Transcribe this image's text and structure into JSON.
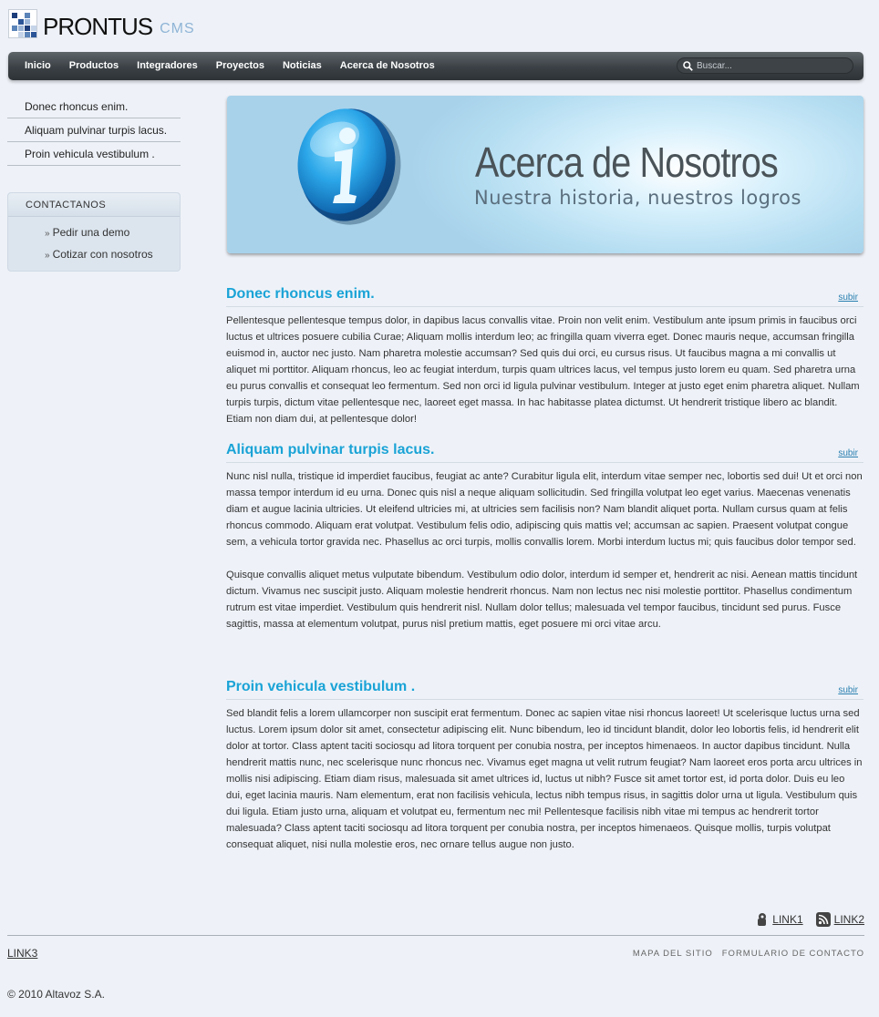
{
  "logo": {
    "name": "PRONTUS",
    "sub": "CMS"
  },
  "nav": {
    "items": [
      "Inicio",
      "Productos",
      "Integradores",
      "Proyectos",
      "Noticias",
      "Acerca de Nosotros"
    ],
    "search_placeholder": "Buscar..."
  },
  "sidebar": {
    "links": [
      "Donec rhoncus enim.",
      "Aliquam pulvinar turpis lacus.",
      "Proin vehicula vestibulum ."
    ],
    "contact": {
      "title": "CONTACTANOS",
      "items": [
        "Pedir una demo",
        "Cotizar con nosotros"
      ]
    }
  },
  "banner": {
    "title": "Acerca de Nosotros",
    "subtitle": "Nuestra historia, nuestros logros"
  },
  "articles": [
    {
      "title": "Donec rhoncus enim.",
      "up": "subir",
      "paragraphs": [
        "Pellentesque pellentesque tempus dolor, in dapibus lacus convallis vitae. Proin non velit enim. Vestibulum ante ipsum primis in faucibus orci luctus et ultrices posuere cubilia Curae; Aliquam mollis interdum leo; ac fringilla quam viverra eget. Donec mauris neque, accumsan fringilla euismod in, auctor nec justo. Nam pharetra molestie accumsan? Sed quis dui orci, eu cursus risus. Ut faucibus magna a mi convallis ut aliquet mi porttitor. Aliquam rhoncus, leo ac feugiat interdum, turpis quam ultrices lacus, vel tempus justo lorem eu quam. Sed pharetra urna eu purus convallis et consequat leo fermentum. Sed non orci id ligula pulvinar vestibulum. Integer at justo eget enim pharetra aliquet. Nullam turpis turpis, dictum vitae pellentesque nec, laoreet eget massa. In hac habitasse platea dictumst. Ut hendrerit tristique libero ac blandit. Etiam non diam dui, at pellentesque dolor!"
      ]
    },
    {
      "title": "Aliquam pulvinar turpis lacus.",
      "up": "subir",
      "paragraphs": [
        "Nunc nisl nulla, tristique id imperdiet faucibus, feugiat ac ante? Curabitur ligula elit, interdum vitae semper nec, lobortis sed dui! Ut et orci non massa tempor interdum id eu urna. Donec quis nisl a neque aliquam sollicitudin. Sed fringilla volutpat leo eget varius. Maecenas venenatis diam et augue lacinia ultricies. Ut eleifend ultricies mi, at ultricies sem facilisis non? Nam blandit aliquet porta. Nullam cursus quam at felis rhoncus commodo. Aliquam erat volutpat. Vestibulum felis odio, adipiscing quis mattis vel; accumsan ac sapien. Praesent volutpat congue sem, a vehicula tortor gravida nec. Phasellus ac orci turpis, mollis convallis lorem. Morbi interdum luctus mi; quis faucibus dolor tempor sed.",
        "Quisque convallis aliquet metus vulputate bibendum. Vestibulum odio dolor, interdum id semper et, hendrerit ac nisi. Aenean mattis tincidunt dictum. Vivamus nec suscipit justo. Aliquam molestie hendrerit rhoncus. Nam non lectus nec nisi molestie porttitor. Phasellus condimentum rutrum est vitae imperdiet. Vestibulum quis hendrerit nisl. Nullam dolor tellus; malesuada vel tempor faucibus, tincidunt sed purus. Fusce sagittis, massa at elementum volutpat, purus nisl pretium mattis, eget posuere mi orci vitae arcu."
      ]
    },
    {
      "title": "Proin vehicula vestibulum .",
      "up": "subir",
      "paragraphs": [
        "Sed blandit felis a lorem ullamcorper non suscipit erat fermentum. Donec ac sapien vitae nisi rhoncus laoreet! Ut scelerisque luctus urna sed luctus. Lorem ipsum dolor sit amet, consectetur adipiscing elit. Nunc bibendum, leo id tincidunt blandit, dolor leo lobortis felis, id hendrerit elit dolor at tortor. Class aptent taciti sociosqu ad litora torquent per conubia nostra, per inceptos himenaeos. In auctor dapibus tincidunt. Nulla hendrerit mattis nunc, nec scelerisque nunc rhoncus nec. Vivamus eget magna ut velit rutrum feugiat? Nam laoreet eros porta arcu ultrices in mollis nisi adipiscing. Etiam diam risus, malesuada sit amet ultrices id, luctus ut nibh? Fusce sit amet tortor est, id porta dolor. Duis eu leo dui, eget lacinia mauris. Nam elementum, erat non facilisis vehicula, lectus nibh tempus risus, in sagittis dolor urna ut ligula. Vestibulum quis dui ligula. Etiam justo urna, aliquam et volutpat eu, fermentum nec mi! Pellentesque facilisis nibh vitae mi tempus ac hendrerit tortor malesuada? Class aptent taciti sociosqu ad litora torquent per conubia nostra, per inceptos himenaeos. Quisque mollis, turpis volutpat consequat aliquet, nisi nulla molestie eros, nec ornare tellus augue non justo."
      ]
    }
  ],
  "footer": {
    "link1": "LINK1",
    "link2": "LINK2",
    "link3": "LINK3",
    "sitemap": "MAPA DEL SITIO",
    "contact_form": "FORMULARIO DE CONTACTO",
    "copyright": "© 2010 Altavoz S.A."
  },
  "icons": {
    "logo": "logo-grid-icon",
    "search": "search-icon",
    "info": "info-icon",
    "link1": "share-icon",
    "link2": "rss-icon"
  },
  "colors": {
    "accent": "#1aa3d6",
    "nav_bg": "#3a4045",
    "page_bg": "#eef2f8"
  }
}
